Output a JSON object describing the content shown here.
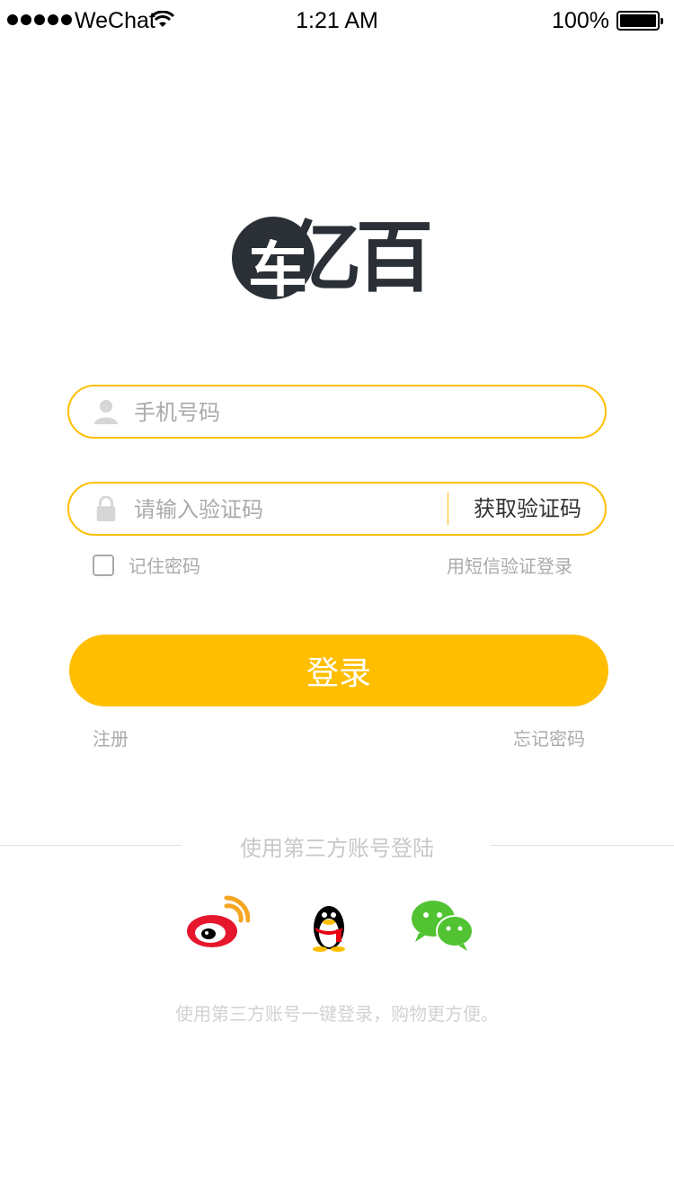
{
  "status_bar": {
    "carrier": "WeChat",
    "time": "1:21 AM",
    "battery": "100%"
  },
  "logo": {
    "mark": "车",
    "text": "亿百"
  },
  "login_form": {
    "phone_placeholder": "手机号码",
    "code_placeholder": "请输入验证码",
    "get_code_label": "获取验证码",
    "remember_label": "记住密码",
    "sms_login_label": "用短信验证登录",
    "login_button": "登录",
    "register_label": "注册",
    "forgot_label": "忘记密码"
  },
  "third_party": {
    "title": "使用第三方账号登陆",
    "tip": "使用第三方账号一键登录，购物更方便。",
    "providers": [
      {
        "name": "weibo-icon"
      },
      {
        "name": "qq-icon"
      },
      {
        "name": "wechat-icon"
      }
    ]
  },
  "colors": {
    "accent": "#ffbe00",
    "placeholder": "#aaaaaa",
    "divider": "#ededed"
  }
}
